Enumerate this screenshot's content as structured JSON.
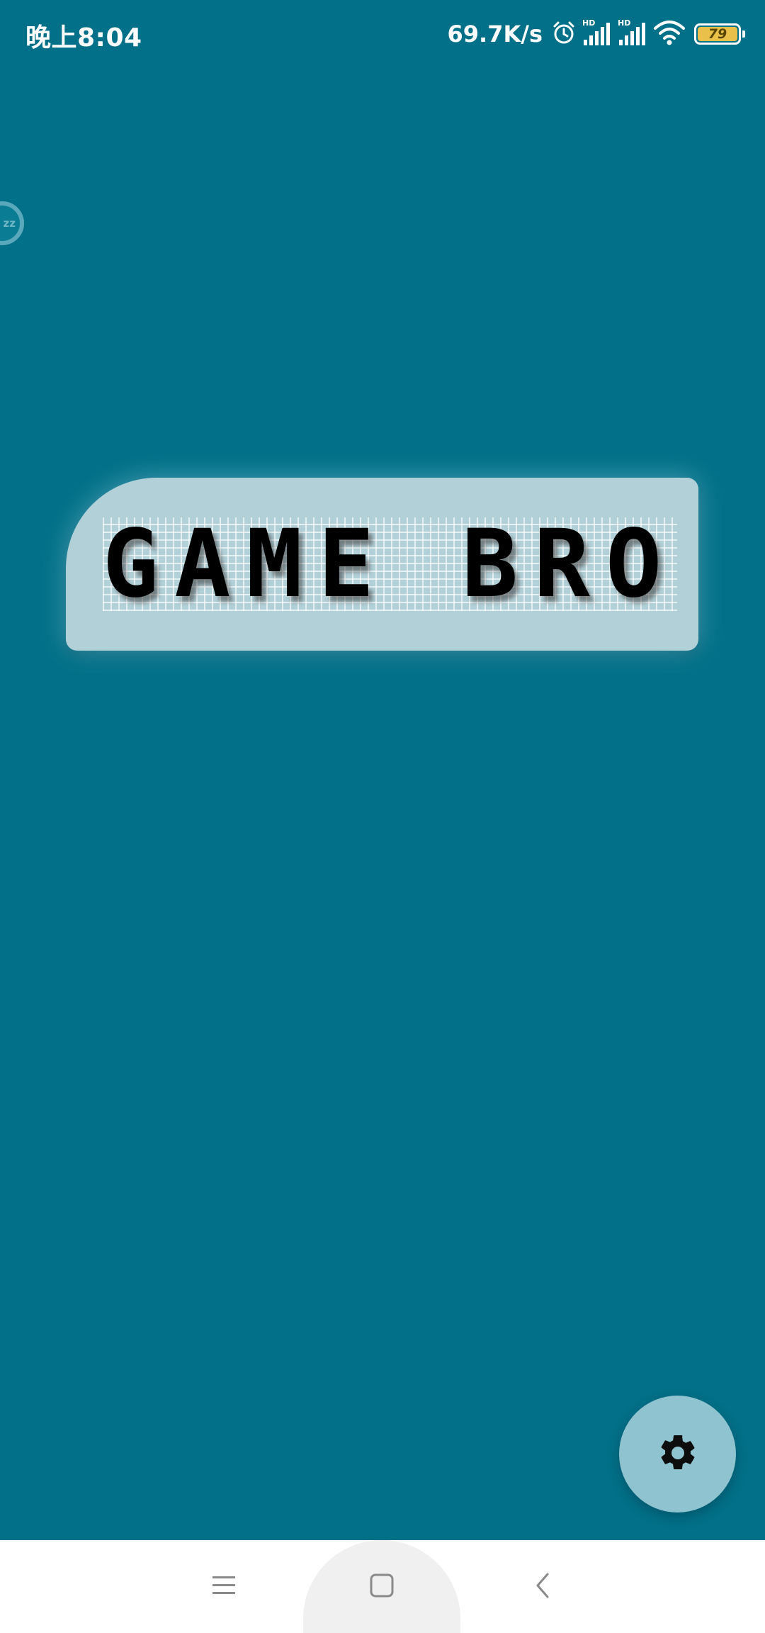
{
  "status_bar": {
    "time": "晚上8:04",
    "net_speed": "69.7K/s",
    "battery_level": "79",
    "icons": [
      "alarm-icon",
      "signal-hd-icon",
      "signal-hd-icon",
      "wifi-icon",
      "battery-icon"
    ]
  },
  "edge_bubble": {
    "label": "zz"
  },
  "title_banner": {
    "title": "GAME BRO"
  },
  "fab": {
    "icon": "gear-icon"
  },
  "nav_bar": {
    "buttons": [
      "menu-icon",
      "home-icon",
      "back-icon"
    ]
  },
  "colors": {
    "background": "#027088",
    "banner": "#b2d0d8",
    "fab": "#8fc3cf",
    "battery": "#e9c14a"
  }
}
